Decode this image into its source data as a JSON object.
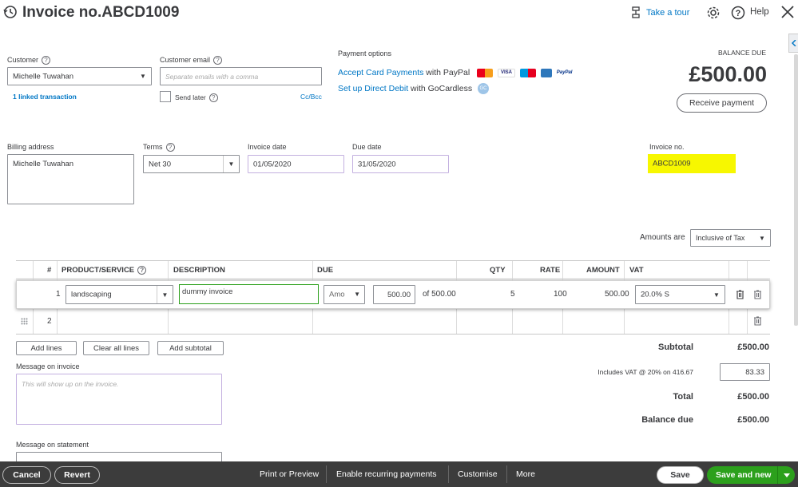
{
  "header": {
    "title": "Invoice no.ABCD1009",
    "take_tour": "Take a tour",
    "help": "Help"
  },
  "customer": {
    "label": "Customer",
    "value": "Michelle Tuwahan",
    "linked": "1 linked transaction"
  },
  "email": {
    "label": "Customer email",
    "placeholder": "Separate emails with a comma",
    "send_later": "Send later",
    "cc_bcc": "Cc/Bcc"
  },
  "payment": {
    "label": "Payment options",
    "line1_link": "Accept Card Payments",
    "line1_rest": " with PayPal",
    "line2_link": "Set up Direct Debit",
    "line2_rest": " with GoCardless",
    "card_logos": [
      "mastercard",
      "VISA",
      "maestro",
      "amex",
      "PayPal"
    ],
    "gc_icon": "GC"
  },
  "balance": {
    "label": "BALANCE DUE",
    "amount": "£500.00",
    "receive_button": "Receive payment"
  },
  "billing": {
    "label": "Billing address",
    "value": "Michelle Tuwahan"
  },
  "terms": {
    "label": "Terms",
    "value": "Net 30"
  },
  "invoice_date": {
    "label": "Invoice date",
    "value": "01/05/2020"
  },
  "due_date": {
    "label": "Due date",
    "value": "31/05/2020"
  },
  "invoice_no": {
    "label": "Invoice no.",
    "value": "ABCD1009",
    "highlight_color": "#f7f700"
  },
  "amounts_are": {
    "label": "Amounts are",
    "value": "Inclusive of Tax"
  },
  "table": {
    "headers": {
      "num": "#",
      "product": "PRODUCT/SERVICE",
      "description": "DESCRIPTION",
      "due": "DUE",
      "qty": "QTY",
      "rate": "RATE",
      "amount": "AMOUNT",
      "vat": "VAT"
    },
    "row1": {
      "num": "1",
      "product": "landscaping",
      "description": "dummy invoice",
      "due_type": "Amo",
      "due_value": "500.00",
      "due_of": "of 500.00",
      "qty": "5",
      "rate": "100",
      "amount": "500.00",
      "vat": "20.0% S"
    },
    "row2": {
      "num": "2"
    }
  },
  "line_buttons": {
    "add_lines": "Add lines",
    "clear_all": "Clear all lines",
    "add_subtotal": "Add subtotal"
  },
  "message_invoice": {
    "label": "Message on invoice",
    "placeholder": "This will show up on the invoice."
  },
  "message_statement": {
    "label": "Message on statement"
  },
  "totals": {
    "subtotal_label": "Subtotal",
    "subtotal_value": "£500.00",
    "vat_label": "Includes VAT @ 20% on 416.67",
    "vat_value": "83.33",
    "total_label": "Total",
    "total_value": "£500.00",
    "balance_label": "Balance due",
    "balance_value": "£500.00"
  },
  "footer": {
    "cancel": "Cancel",
    "revert": "Revert",
    "print": "Print or Preview",
    "recurring": "Enable recurring payments",
    "customise": "Customise",
    "more": "More",
    "save": "Save",
    "save_new": "Save and new"
  },
  "colors": {
    "accent_green": "#2ca01c",
    "link_blue": "#0077c5",
    "footer_bg": "#3c3c3c"
  }
}
